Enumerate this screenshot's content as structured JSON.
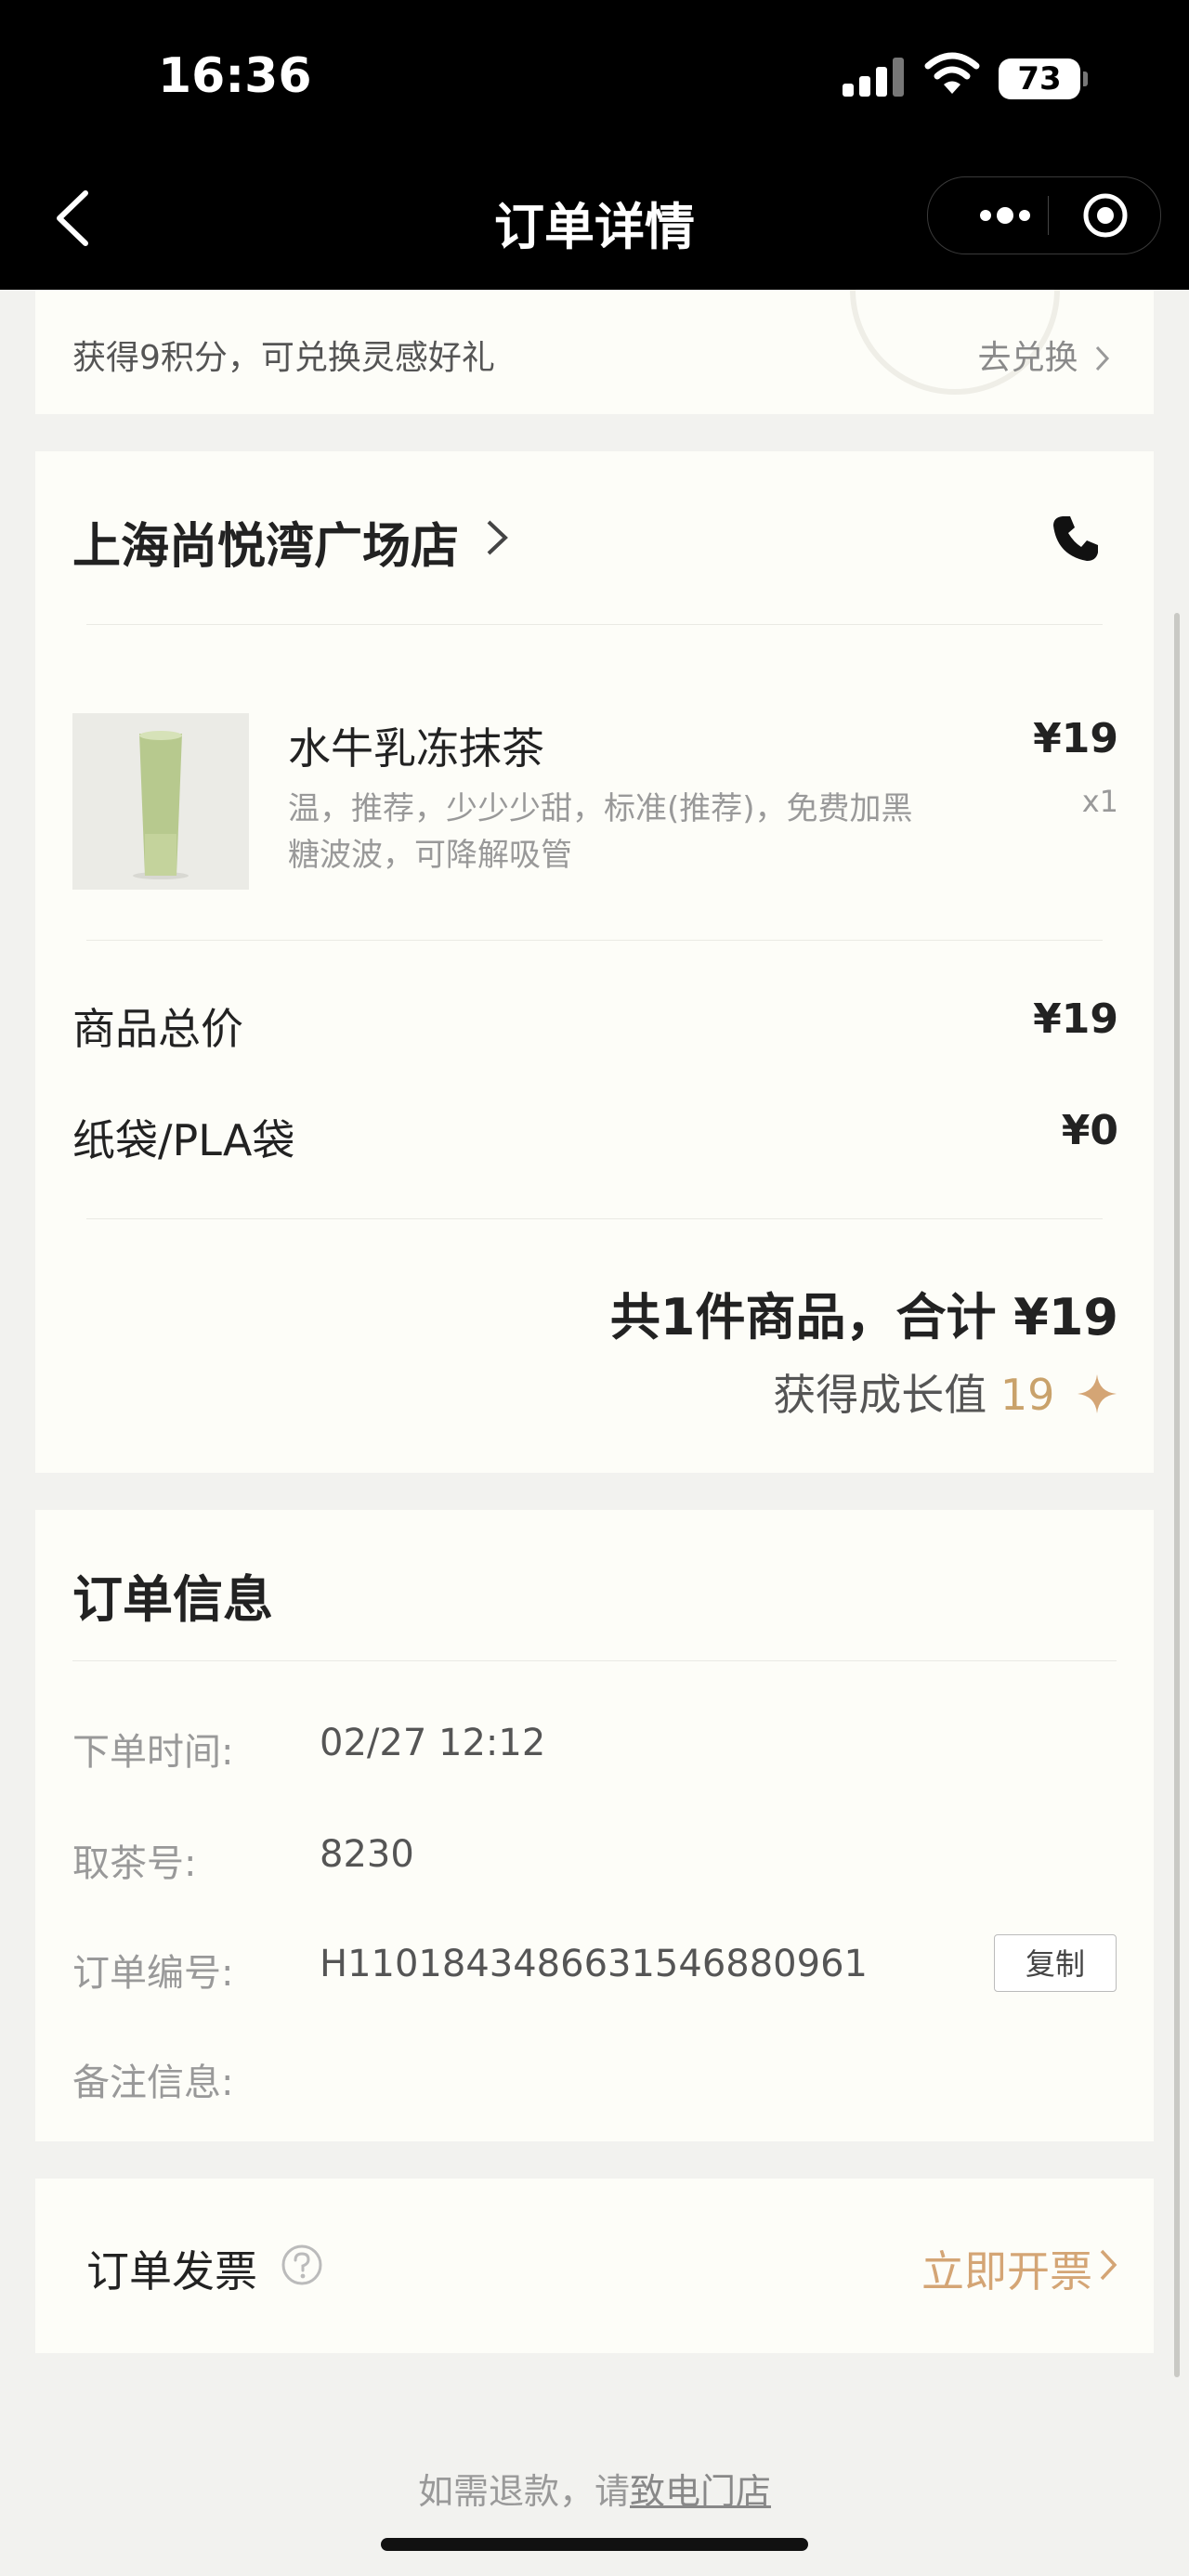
{
  "status_bar": {
    "time": "16:36",
    "battery": "73"
  },
  "nav": {
    "title": "订单详情"
  },
  "points": {
    "text": "获得9积分，可兑换灵感好礼",
    "action": "去兑换"
  },
  "store": {
    "name": "上海尚悦湾广场店"
  },
  "product": {
    "name": "水牛乳冻抹茶",
    "options": "温，推荐，少少少甜，标准(推荐)，免费加黑糖波波，可降解吸管",
    "price": "¥19",
    "quantity": "x1"
  },
  "summary": {
    "goods_total_label": "商品总价",
    "goods_total_value": "¥19",
    "bag_label": "纸袋/PLA袋",
    "bag_value": "¥0",
    "total_text": "共1件商品，合计 ¥19",
    "growth_label": "获得成长值",
    "growth_value": "19"
  },
  "order_info": {
    "title": "订单信息",
    "rows": [
      {
        "label": "下单时间:",
        "value": "02/27 12:12"
      },
      {
        "label": "取茶号:",
        "value": "8230"
      },
      {
        "label": "订单编号:",
        "value": "H1101843486631546880961"
      },
      {
        "label": "备注信息:",
        "value": ""
      }
    ],
    "copy_label": "复制"
  },
  "invoice": {
    "title": "订单发票",
    "action": "立即开票"
  },
  "footer": {
    "refund_prefix": "如需退款，请",
    "refund_link": "致电门店"
  },
  "colors": {
    "accent_gold": "#d4a575",
    "growth_gold": "#c9a26b",
    "card_bg": "#fdfdf8",
    "page_bg": "#f2f2ef"
  },
  "icons": [
    "back-icon",
    "more-icon",
    "target-icon",
    "chevron-right-icon",
    "phone-icon",
    "sparkle-icon",
    "help-icon"
  ]
}
